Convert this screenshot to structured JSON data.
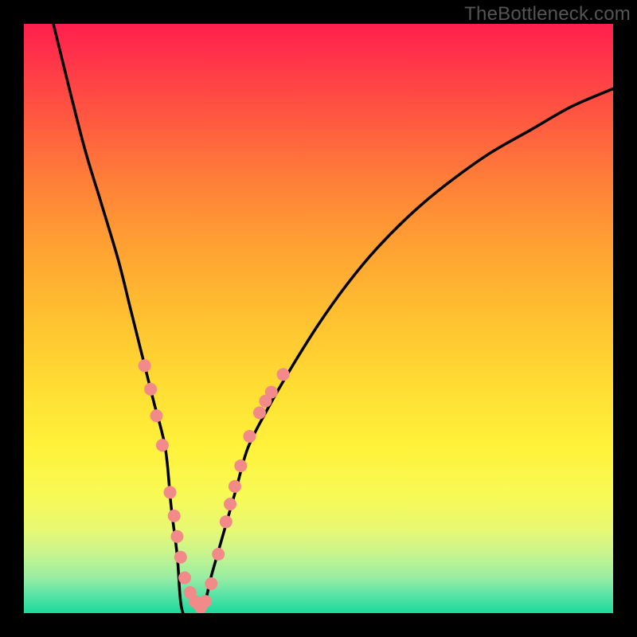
{
  "watermark": "TheBottleneck.com",
  "colors": {
    "black": "#000000",
    "curve": "#000000",
    "dot_fill": "#f28a8a",
    "dot_stroke": "#c95b5b",
    "gradient_top": "#ff1f4d",
    "gradient_bottom": "#1bd99b"
  },
  "chart_data": {
    "type": "line",
    "title": "",
    "xlabel": "",
    "ylabel": "",
    "x": [
      0.05,
      0.1,
      0.13,
      0.16,
      0.18,
      0.2,
      0.22,
      0.24,
      0.25,
      0.26,
      0.27,
      0.3,
      0.32,
      0.34,
      0.36,
      0.38,
      0.41,
      0.45,
      0.5,
      0.55,
      0.6,
      0.66,
      0.72,
      0.79,
      0.86,
      0.93,
      1.0
    ],
    "values": [
      1.0,
      0.8,
      0.7,
      0.6,
      0.52,
      0.44,
      0.36,
      0.28,
      0.18,
      0.1,
      0.0,
      0.0,
      0.07,
      0.14,
      0.21,
      0.28,
      0.34,
      0.41,
      0.49,
      0.56,
      0.62,
      0.68,
      0.73,
      0.78,
      0.82,
      0.86,
      0.89
    ],
    "ylim": [
      0,
      1
    ],
    "xlim": [
      0,
      1
    ],
    "series": [
      {
        "name": "curve",
        "x": [
          0.05,
          0.1,
          0.13,
          0.16,
          0.18,
          0.2,
          0.22,
          0.24,
          0.25,
          0.26,
          0.27,
          0.3,
          0.32,
          0.34,
          0.36,
          0.38,
          0.41,
          0.45,
          0.5,
          0.55,
          0.6,
          0.66,
          0.72,
          0.79,
          0.86,
          0.93,
          1.0
        ],
        "y": [
          1.0,
          0.8,
          0.7,
          0.6,
          0.52,
          0.44,
          0.36,
          0.28,
          0.18,
          0.1,
          0.0,
          0.0,
          0.07,
          0.14,
          0.21,
          0.28,
          0.34,
          0.41,
          0.49,
          0.56,
          0.62,
          0.68,
          0.73,
          0.78,
          0.82,
          0.86,
          0.89
        ]
      }
    ],
    "marker_points": [
      {
        "x": 0.205,
        "y": 0.42
      },
      {
        "x": 0.215,
        "y": 0.38
      },
      {
        "x": 0.225,
        "y": 0.335
      },
      {
        "x": 0.235,
        "y": 0.285
      },
      {
        "x": 0.248,
        "y": 0.205
      },
      {
        "x": 0.255,
        "y": 0.165
      },
      {
        "x": 0.26,
        "y": 0.13
      },
      {
        "x": 0.266,
        "y": 0.095
      },
      {
        "x": 0.273,
        "y": 0.06
      },
      {
        "x": 0.282,
        "y": 0.035
      },
      {
        "x": 0.29,
        "y": 0.02
      },
      {
        "x": 0.3,
        "y": 0.01
      },
      {
        "x": 0.308,
        "y": 0.02
      },
      {
        "x": 0.318,
        "y": 0.05
      },
      {
        "x": 0.33,
        "y": 0.1
      },
      {
        "x": 0.343,
        "y": 0.155
      },
      {
        "x": 0.35,
        "y": 0.185
      },
      {
        "x": 0.358,
        "y": 0.215
      },
      {
        "x": 0.368,
        "y": 0.25
      },
      {
        "x": 0.383,
        "y": 0.3
      },
      {
        "x": 0.4,
        "y": 0.34
      },
      {
        "x": 0.41,
        "y": 0.36
      },
      {
        "x": 0.42,
        "y": 0.375
      },
      {
        "x": 0.44,
        "y": 0.405
      }
    ]
  }
}
